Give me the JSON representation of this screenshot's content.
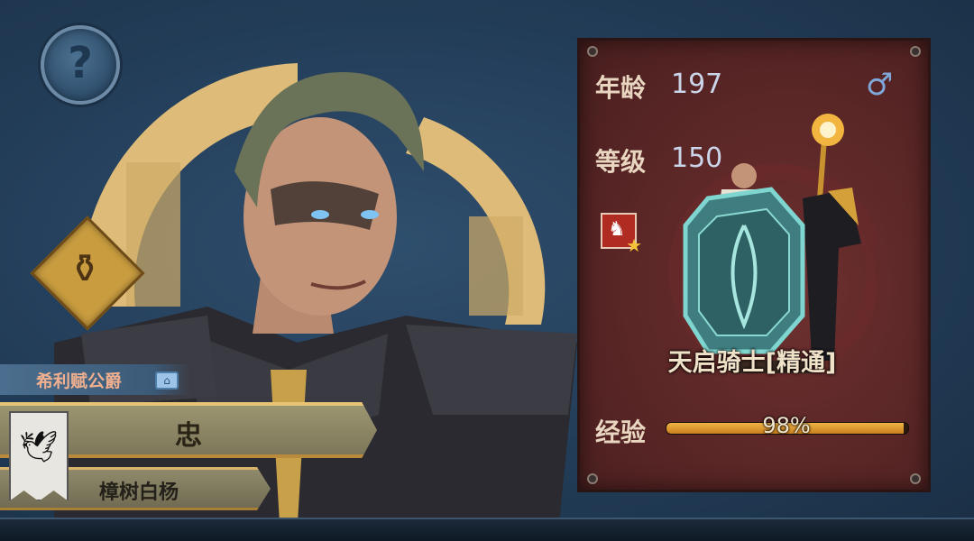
{
  "character": {
    "title": "希利赋公爵",
    "trait": "忠",
    "house": "樟树白杨"
  },
  "stats": {
    "age_label": "年龄",
    "age_value": "197",
    "level_label": "等级",
    "level_value": "150",
    "exp_label": "经验",
    "exp_percent_text": "98%",
    "exp_progress": 0.98
  },
  "unit_class": {
    "name": "天启骑士[精通]"
  },
  "icons": {
    "help": "help-icon",
    "gender": "male-icon",
    "class_badge": "cavalry-icon",
    "potion": "potion-icon",
    "rank": "rank-icon",
    "banner": "raven-banner-icon"
  },
  "colors": {
    "panel": "#5a2626",
    "background": "#223c57",
    "gold": "#e6c375",
    "stat_value": "#cbd5ea"
  }
}
